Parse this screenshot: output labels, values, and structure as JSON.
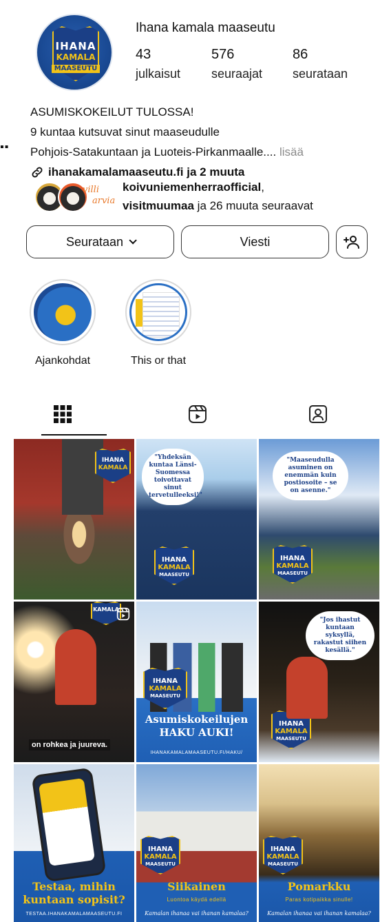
{
  "profile": {
    "name": "Ihana kamala maaseutu",
    "avatar_logo": {
      "line1": "IHANA",
      "line2": "KAMALA",
      "line3": "MAASEUTU"
    },
    "stats": [
      {
        "value": "43",
        "label": "julkaisut"
      },
      {
        "value": "576",
        "label": "seuraajat"
      },
      {
        "value": "86",
        "label": "seurataan"
      }
    ]
  },
  "bio": {
    "line1": "ASUMISKOKEILUT TULOSSA!",
    "line2": "9 kuntaa kutsuvat sinut maaseudulle",
    "line3": "Pohjois-Satakuntaan ja Luoteis-Pirkanmaalle....",
    "more": "lisää",
    "link": "ihanakamalamaaseutu.fi ja 2 muuta"
  },
  "followed_by": {
    "name1": "koivuniemenherraofficial",
    "name2": "visitmuumaa",
    "rest": " ja 26 muuta seuraavat",
    "badge_text": {
      "line1": "villi",
      "line2": "arvia"
    }
  },
  "buttons": {
    "follow": "Seurataan",
    "message": "Viesti"
  },
  "highlights": [
    {
      "label": "Ajankohdat"
    },
    {
      "label": "This or that"
    }
  ],
  "tabs": [
    {
      "icon": "grid-icon"
    },
    {
      "icon": "reels-icon"
    },
    {
      "icon": "tagged-icon"
    }
  ],
  "posts": {
    "p2_bubble": "\"Yhdeksän kuntaa Länsi-Suomessa toivottavat sinut tervetulleeksi!\"",
    "p3_bubble": "\"Maaseudulla asuminen on enemmän kuin postiosoite – se on asenne.\"",
    "p4_caption": "on rohkea ja juureva.",
    "p5_title": "Asumiskokeilujen HAKU AUKI!",
    "p5_url": "IHANAKAMALAMAASEUTU.FI/HAKU/",
    "p6_bubble": "\"Jos ihastut kuntaan syksyllä, rakastut siihen kesällä.\"",
    "p7_title": "Testaa, mihin kuntaan sopisit?",
    "p7_url": "TESTAA.IHANAKAMALAMAASEUTU.FI",
    "p8_title": "Siikainen",
    "p8_sub": "Luontoa käydä edellä",
    "p8_tag": "Kamalan ihanaa vai ihanan kamalaa?",
    "p9_title": "Pomarkku",
    "p9_sub": "Paras kotipaikka sinulle!",
    "p9_tag": "Kamalan ihanaa vai ihanan kamalaa?",
    "badge": {
      "line1": "IHANA",
      "line2": "KAMALA",
      "line3": "MAASEUTU"
    }
  },
  "colors": {
    "brand_blue": "#1b3f86",
    "brand_yellow": "#f2c318",
    "link_gray": "#8a8a8a"
  }
}
